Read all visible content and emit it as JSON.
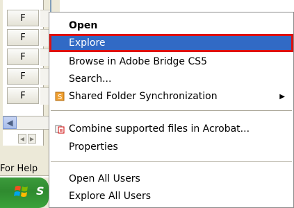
{
  "background": {
    "f_buttons": [
      "F",
      "F",
      "F",
      "F",
      "F"
    ],
    "help_text": "For Help",
    "start_label": "S"
  },
  "menu": {
    "items": [
      {
        "label": "Open"
      },
      {
        "label": "Explore"
      },
      {
        "label": "Browse in Adobe Bridge CS5"
      },
      {
        "label": "Search..."
      },
      {
        "label": "Shared Folder Synchronization"
      },
      {
        "label": "Combine supported files in Acrobat..."
      },
      {
        "label": "Properties"
      },
      {
        "label": "Open All Users"
      },
      {
        "label": "Explore All Users"
      }
    ]
  },
  "colors": {
    "highlight": "#316ac5",
    "highlight_border": "#dd1111"
  },
  "icons": {
    "shared_folder": "sync-icon",
    "combine": "acrobat-icon",
    "submenu": "chevron-right-icon"
  }
}
